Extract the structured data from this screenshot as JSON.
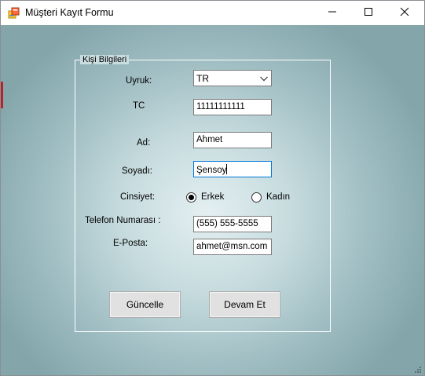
{
  "window": {
    "title": "Müşteri Kayıt Formu",
    "icon": "form-app-icon",
    "controls": {
      "minimize": "minimize-icon",
      "maximize": "maximize-icon",
      "close": "close-icon"
    }
  },
  "group": {
    "title": "Kişi Bilgileri"
  },
  "fields": {
    "nationality": {
      "label": "Uyruk:",
      "value": "TR"
    },
    "tc": {
      "label": "TC",
      "value": "11111111111"
    },
    "first_name": {
      "label": "Ad:",
      "value": "Ahmet"
    },
    "last_name": {
      "label": "Soyadı:",
      "value": "Şensoy"
    },
    "gender": {
      "label": "Cinsiyet:",
      "options": [
        {
          "label": "Erkek",
          "checked": true
        },
        {
          "label": "Kadın",
          "checked": false
        }
      ]
    },
    "phone": {
      "label": "Telefon Numarası :",
      "value": "(555) 555-5555"
    },
    "email": {
      "label": "E-Posta:",
      "value": "ahmet@msn.com"
    }
  },
  "buttons": {
    "update": "Güncelle",
    "continue": "Devam Et"
  },
  "colors": {
    "focus_border": "#0078d7",
    "background_center": "#e4eff1",
    "background_edge": "#84a6ab"
  }
}
